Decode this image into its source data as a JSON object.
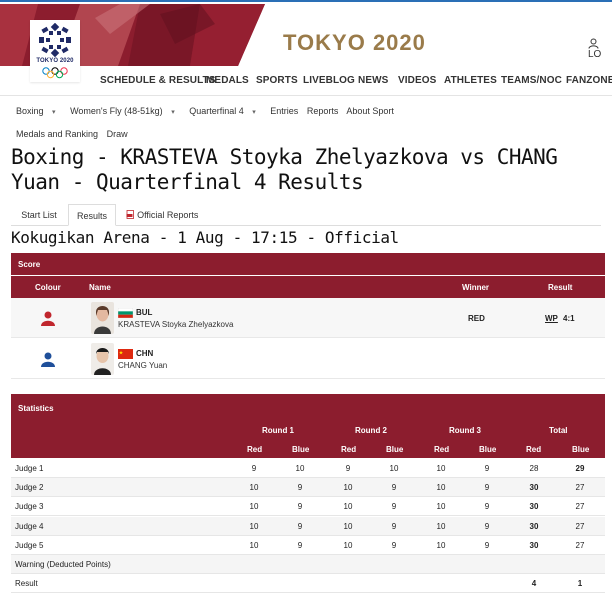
{
  "header": {
    "logo_text": "TOKYO 2020",
    "title": "TOKYO 2020",
    "login": "LO"
  },
  "main_nav": [
    "SCHEDULE & RESULTS",
    "MEDALS",
    "SPORTS",
    "LIVEBLOG",
    "NEWS",
    "VIDEOS",
    "ATHLETES",
    "TEAMS/NOC",
    "FANZONE"
  ],
  "sub_nav": {
    "row1": [
      {
        "label": "Boxing",
        "dropdown": true
      },
      {
        "label": "Women's Fly (48-51kg)",
        "dropdown": true
      },
      {
        "label": "Quarterfinal 4",
        "dropdown": true
      },
      {
        "label": "Entries",
        "dropdown": false
      },
      {
        "label": "Reports",
        "dropdown": false
      },
      {
        "label": "About Sport",
        "dropdown": false
      }
    ],
    "row2": [
      {
        "label": "Medals and Ranking"
      },
      {
        "label": "Draw"
      }
    ]
  },
  "page_title": "Boxing - KRASTEVA Stoyka Zhelyazkova vs CHANG Yuan - Quarterfinal 4 Results",
  "tabs": [
    "Start List",
    "Results",
    "Official Reports"
  ],
  "venue_line": "Kokugikan Arena - 1 Aug - 17:15 - Official",
  "score": {
    "section_label": "Score",
    "columns": {
      "colour": "Colour",
      "name": "Name",
      "winner": "Winner",
      "result": "Result"
    },
    "rows": [
      {
        "corner": "red",
        "noc": "BUL",
        "name": "KRASTEVA Stoyka Zhelyazkova",
        "winner": "RED",
        "method": "WP",
        "score": "4:1"
      },
      {
        "corner": "blue",
        "noc": "CHN",
        "name": "CHANG Yuan",
        "winner": "",
        "method": "",
        "score": ""
      }
    ]
  },
  "statistics": {
    "section_label": "Statistics",
    "rounds": [
      "Round 1",
      "Round 2",
      "Round 3",
      "Total"
    ],
    "red_label": "Red",
    "blue_label": "Blue",
    "rows": [
      {
        "label": "Judge 1",
        "values": [
          "9",
          "10",
          "9",
          "10",
          "10",
          "9",
          "28",
          "29"
        ],
        "bold_total": "blue"
      },
      {
        "label": "Judge 2",
        "values": [
          "10",
          "9",
          "10",
          "9",
          "10",
          "9",
          "30",
          "27"
        ],
        "bold_total": "red"
      },
      {
        "label": "Judge 3",
        "values": [
          "10",
          "9",
          "10",
          "9",
          "10",
          "9",
          "30",
          "27"
        ],
        "bold_total": "red"
      },
      {
        "label": "Judge 4",
        "values": [
          "10",
          "9",
          "10",
          "9",
          "10",
          "9",
          "30",
          "27"
        ],
        "bold_total": "red"
      },
      {
        "label": "Judge 5",
        "values": [
          "10",
          "9",
          "10",
          "9",
          "10",
          "9",
          "30",
          "27"
        ],
        "bold_total": "red"
      },
      {
        "label": "Warning (Deducted Points)",
        "values": [
          "",
          "",
          "",
          "",
          "",
          "",
          "",
          ""
        ],
        "bold_total": "none"
      },
      {
        "label": "Result",
        "values": [
          "",
          "",
          "",
          "",
          "",
          "",
          "4",
          "1"
        ],
        "bold_total": "both"
      }
    ]
  },
  "colors": {
    "maroon": "#8c1d2e",
    "gold": "#9a7b4a",
    "red_corner": "#c0262d",
    "blue_corner": "#1f4f9a"
  }
}
